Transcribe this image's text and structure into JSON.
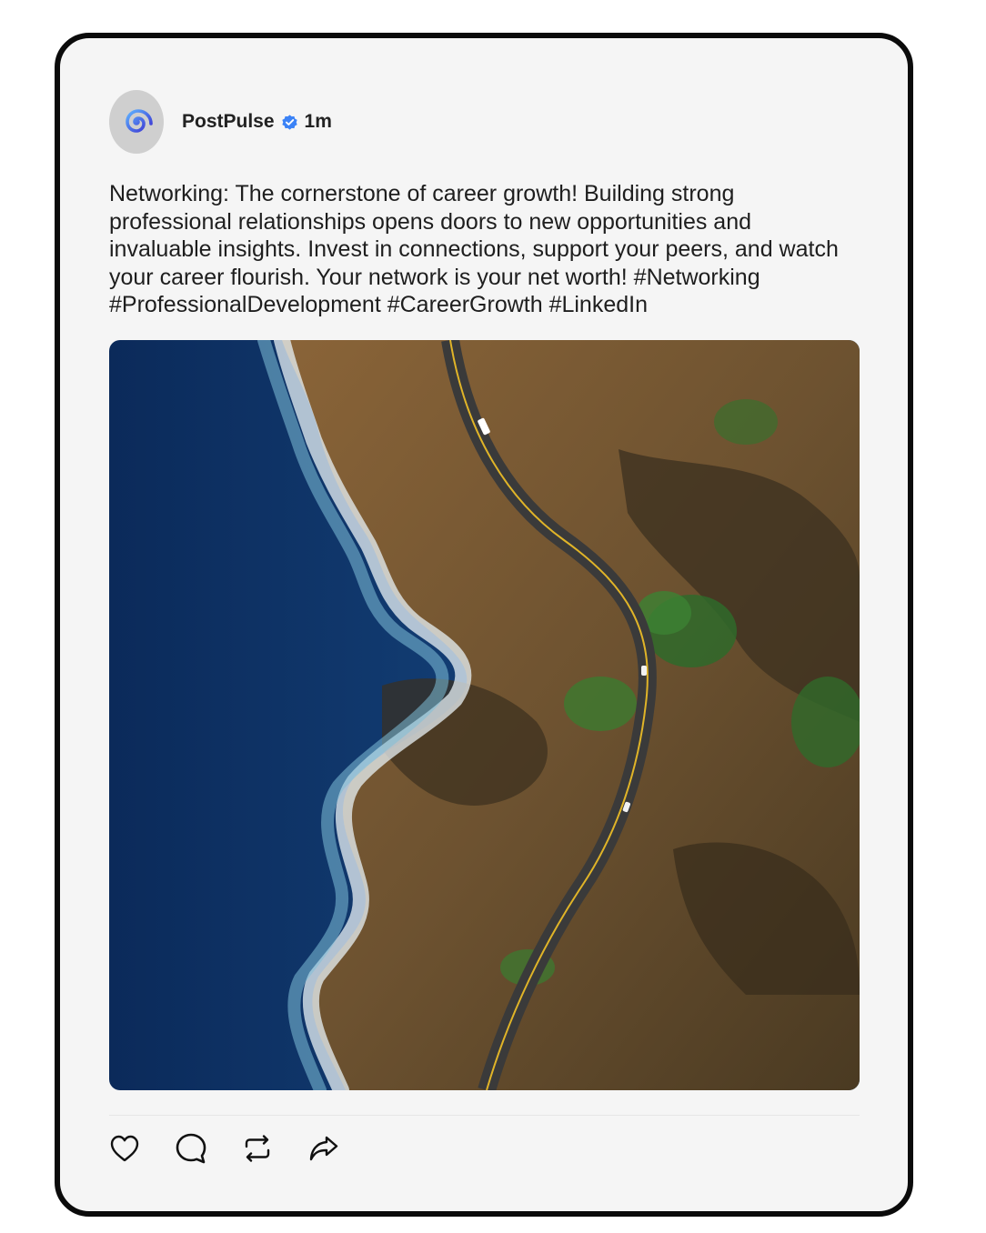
{
  "post": {
    "author": "PostPulse",
    "time": "1m",
    "text": "Networking: The cornerstone of career growth! Building strong professional relationships opens doors to new opportunities and invaluable insights. Invest in connections, support your peers, and watch your career flourish. Your network is your net worth! #Networking #ProfessionalDevelopment #CareerGrowth #LinkedIn"
  },
  "icons": {
    "avatar": "swirl-logo-icon",
    "verified": "verified-badge-icon",
    "like": "heart-icon",
    "comment": "comment-bubble-icon",
    "repost": "repost-icon",
    "share": "share-arrow-icon"
  },
  "colors": {
    "card_background": "#f5f5f5",
    "card_border": "#0b0b0b",
    "verified_badge": "#3b82f6",
    "avatar_logo": "#3f5bdc"
  }
}
